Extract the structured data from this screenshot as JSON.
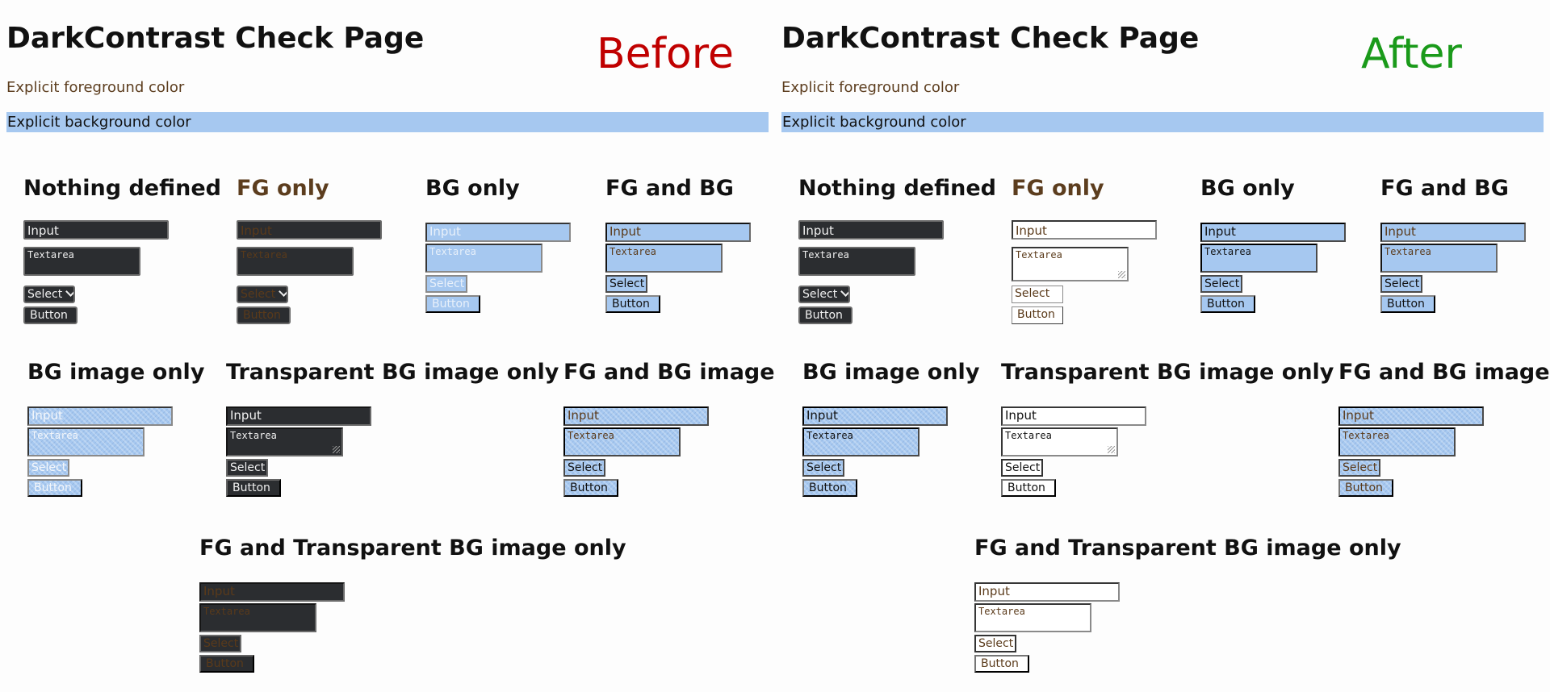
{
  "title": "DarkContrast Check Page",
  "before_tag": "Before",
  "after_tag": "After",
  "colors": {
    "before_tag": "#c00000",
    "after_tag": "#1a9a1a",
    "brown_fg": "#5c3d1e",
    "light_blue_bg": "#a6c8f0",
    "dark_control_bg": "#2b2d30"
  },
  "fg_text": "Explicit foreground color",
  "bg_text": "Explicit background color",
  "sections": {
    "nothing_defined": "Nothing defined",
    "fg_only": "FG only",
    "bg_only": "BG only",
    "fg_and_bg": "FG and BG",
    "bg_image_only": "BG image only",
    "transparent_bg_image_only": "Transparent BG image only",
    "fg_and_bg_image": "FG and BG image",
    "fg_and_transparent_bg_image_only": "FG and Transparent BG image only"
  },
  "controls": {
    "input": "Input",
    "textarea": "Textarea",
    "select": "Select",
    "button": "Button"
  },
  "icons": {
    "select_arrow": "chevron-down-icon",
    "textarea_resize": "resize-grip-icon"
  }
}
